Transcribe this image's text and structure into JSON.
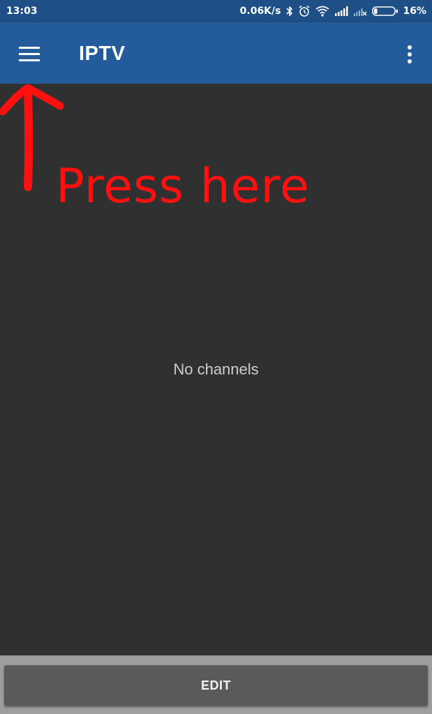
{
  "status_bar": {
    "time": "13:03",
    "net_speed": "0.06K/s",
    "battery_percent": "16%",
    "battery_level": 0.16,
    "icons": [
      "bluetooth-icon",
      "alarm-icon",
      "wifi-icon",
      "signal-icon",
      "signal-no-sim-icon",
      "battery-icon"
    ]
  },
  "app_bar": {
    "title": "IPTV",
    "menu_icon": "hamburger-menu-icon",
    "overflow_icon": "more-vert-icon",
    "color": "#245b9a"
  },
  "content": {
    "empty_message": "No channels"
  },
  "annotation": {
    "text": "Press here",
    "color": "#ff1010"
  },
  "bottom": {
    "edit_label": "EDIT"
  }
}
